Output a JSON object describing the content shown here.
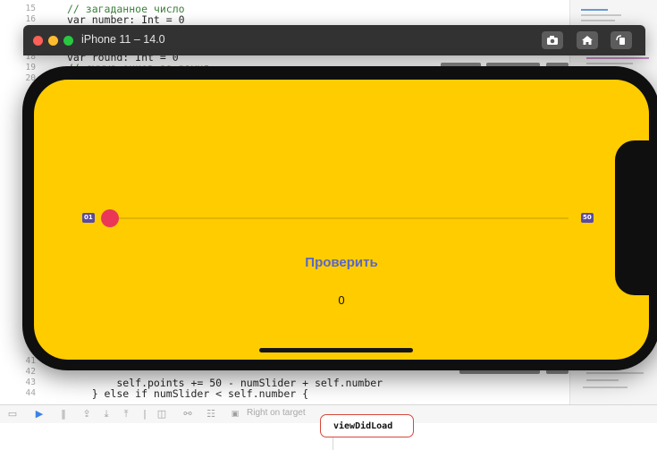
{
  "editor": {
    "lines": [
      {
        "num": "15",
        "text": "// загаданное число",
        "kind": "comment"
      },
      {
        "num": "16",
        "text": "var number: Int = 0",
        "kind": "plain"
      },
      {
        "num": "18",
        "text": "var round: Int = 0",
        "kind": "plain"
      },
      {
        "num": "19",
        "text": "// сумма очков за раунд",
        "kind": "comment"
      },
      {
        "num": "20",
        "text": "",
        "kind": "plain"
      }
    ],
    "bottom_lines": [
      {
        "num": "41",
        "text": "",
        "kind": "plain"
      },
      {
        "num": "42",
        "text": "",
        "kind": "plain"
      },
      {
        "num": "43",
        "text": "        self.points += 50 - numSlider + self.number",
        "kind": "plain"
      },
      {
        "num": "44",
        "text": "    } else if numSlider < self.number {",
        "kind": "plain"
      }
    ]
  },
  "debug_bar": {
    "breakpoint_text": "Right on target",
    "console_output": "viewDidLoad"
  },
  "simulator": {
    "title": "iPhone 11 – 14.0",
    "buttons": {
      "screenshot_icon": "camera-icon",
      "home_icon": "home-icon",
      "rotate_icon": "rotate-icon"
    }
  },
  "app": {
    "background_color": "#ffcc00",
    "slider": {
      "min_label": "01",
      "max_label": "50",
      "min": 1,
      "max": 50,
      "value": 1,
      "accent": "#ea3757"
    },
    "check_button_label": "Проверить",
    "score": "0"
  }
}
